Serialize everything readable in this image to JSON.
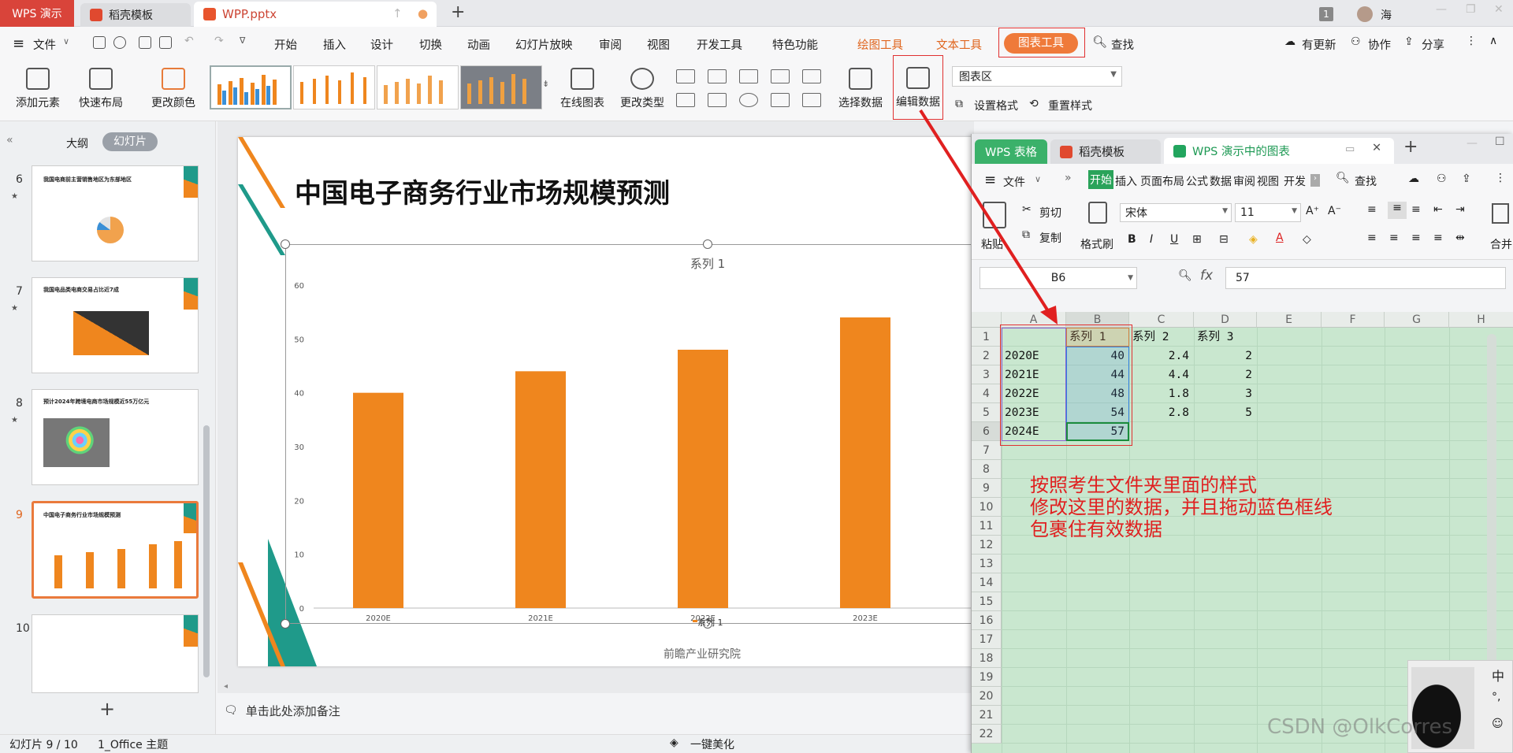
{
  "titlebar": {
    "app_tab": "WPS 演示",
    "tab_daoke": "稻壳模板",
    "tab_file": "WPP.pptx",
    "new_tab": "+",
    "badge": "1",
    "user": "海"
  },
  "menu": {
    "file": "文件",
    "items": [
      "开始",
      "插入",
      "设计",
      "切换",
      "动画",
      "幻灯片放映",
      "审阅",
      "视图",
      "开发工具",
      "特色功能"
    ],
    "drawing_tools": "绘图工具",
    "text_tools": "文本工具",
    "chart_tools": "图表工具",
    "search": "查找",
    "update": "有更新",
    "collab": "协作",
    "share": "分享"
  },
  "ribbon": {
    "add_element": "添加元素",
    "quick_layout": "快速布局",
    "change_color": "更改颜色",
    "online_chart": "在线图表",
    "change_type": "更改类型",
    "select_data": "选择数据",
    "edit_data": "编辑数据",
    "chart_area": "图表区",
    "set_format": "设置格式",
    "reset_style": "重置样式"
  },
  "left_panel": {
    "outline_tab": "大纲",
    "slides_tab": "幻灯片",
    "slides": [
      {
        "num": "6",
        "title": "我国电商前主营销售地区为东部地区"
      },
      {
        "num": "7",
        "title": "我国电品类电商交易占比近7成"
      },
      {
        "num": "8",
        "title": "预计2024年跨境电商市场规模近55万亿元"
      },
      {
        "num": "9",
        "title": "中国电子商务行业市场规模预测"
      },
      {
        "num": "10",
        "title": ""
      }
    ],
    "add": "+"
  },
  "slide": {
    "title": "中国电子商务行业市场规模预测",
    "source": "前瞻产业研究院"
  },
  "chart_data": {
    "type": "bar",
    "title": "系列 1",
    "categories": [
      "2020E",
      "2021E",
      "2022E",
      "2023E"
    ],
    "series": [
      {
        "name": "系列 1",
        "values": [
          40,
          44,
          48,
          54
        ],
        "color": "#ef861e"
      }
    ],
    "ylim": [
      0,
      60
    ],
    "yticks": [
      "0",
      "10",
      "20",
      "30",
      "40",
      "50",
      "60"
    ],
    "legend": "bottom",
    "grid": false
  },
  "notes": {
    "placeholder": "单击此处添加备注"
  },
  "status": {
    "slide_count": "幻灯片 9 / 10",
    "theme": "1_Office 主题",
    "beautify": "一键美化"
  },
  "sheet": {
    "tab_et": "WPS 表格",
    "tab_daoke": "稻壳模板",
    "tab_chart": "WPS 演示中的图表",
    "file": "文件",
    "menu_items": [
      "开始",
      "插入",
      "页面布局",
      "公式",
      "数据",
      "审阅",
      "视图",
      "开发"
    ],
    "search": "查找",
    "cut": "剪切",
    "copy": "复制",
    "paste": "粘贴",
    "format_painter": "格式刷",
    "font": "宋体",
    "font_size": "11",
    "merge": "合并",
    "name_box": "B6",
    "fx": "fx",
    "formula_value": "57",
    "col_headers": [
      "A",
      "B",
      "C",
      "D",
      "E",
      "F",
      "G",
      "H"
    ],
    "row_headers": [
      "1",
      "2",
      "3",
      "4",
      "5",
      "6",
      "7",
      "8",
      "9",
      "10",
      "11",
      "12",
      "13",
      "14",
      "15",
      "16",
      "17",
      "18",
      "19",
      "20",
      "21",
      "22"
    ],
    "header_row": [
      "",
      "系列 1",
      "系列 2",
      "系列 3"
    ],
    "rows": [
      [
        "2020E",
        "40",
        "2.4",
        "2"
      ],
      [
        "2021E",
        "44",
        "4.4",
        "2"
      ],
      [
        "2022E",
        "48",
        "1.8",
        "3"
      ],
      [
        "2023E",
        "54",
        "2.8",
        "5"
      ],
      [
        "2024E",
        "57",
        "",
        ""
      ]
    ],
    "annotation": [
      "按照考生文件夹里面的样式",
      "修改这里的数据，并且拖动蓝色框线",
      "包裹住有效数据"
    ]
  },
  "ime": {
    "lang": "中",
    "punct": "°,"
  },
  "watermark": "CSDN @OlkCorres"
}
